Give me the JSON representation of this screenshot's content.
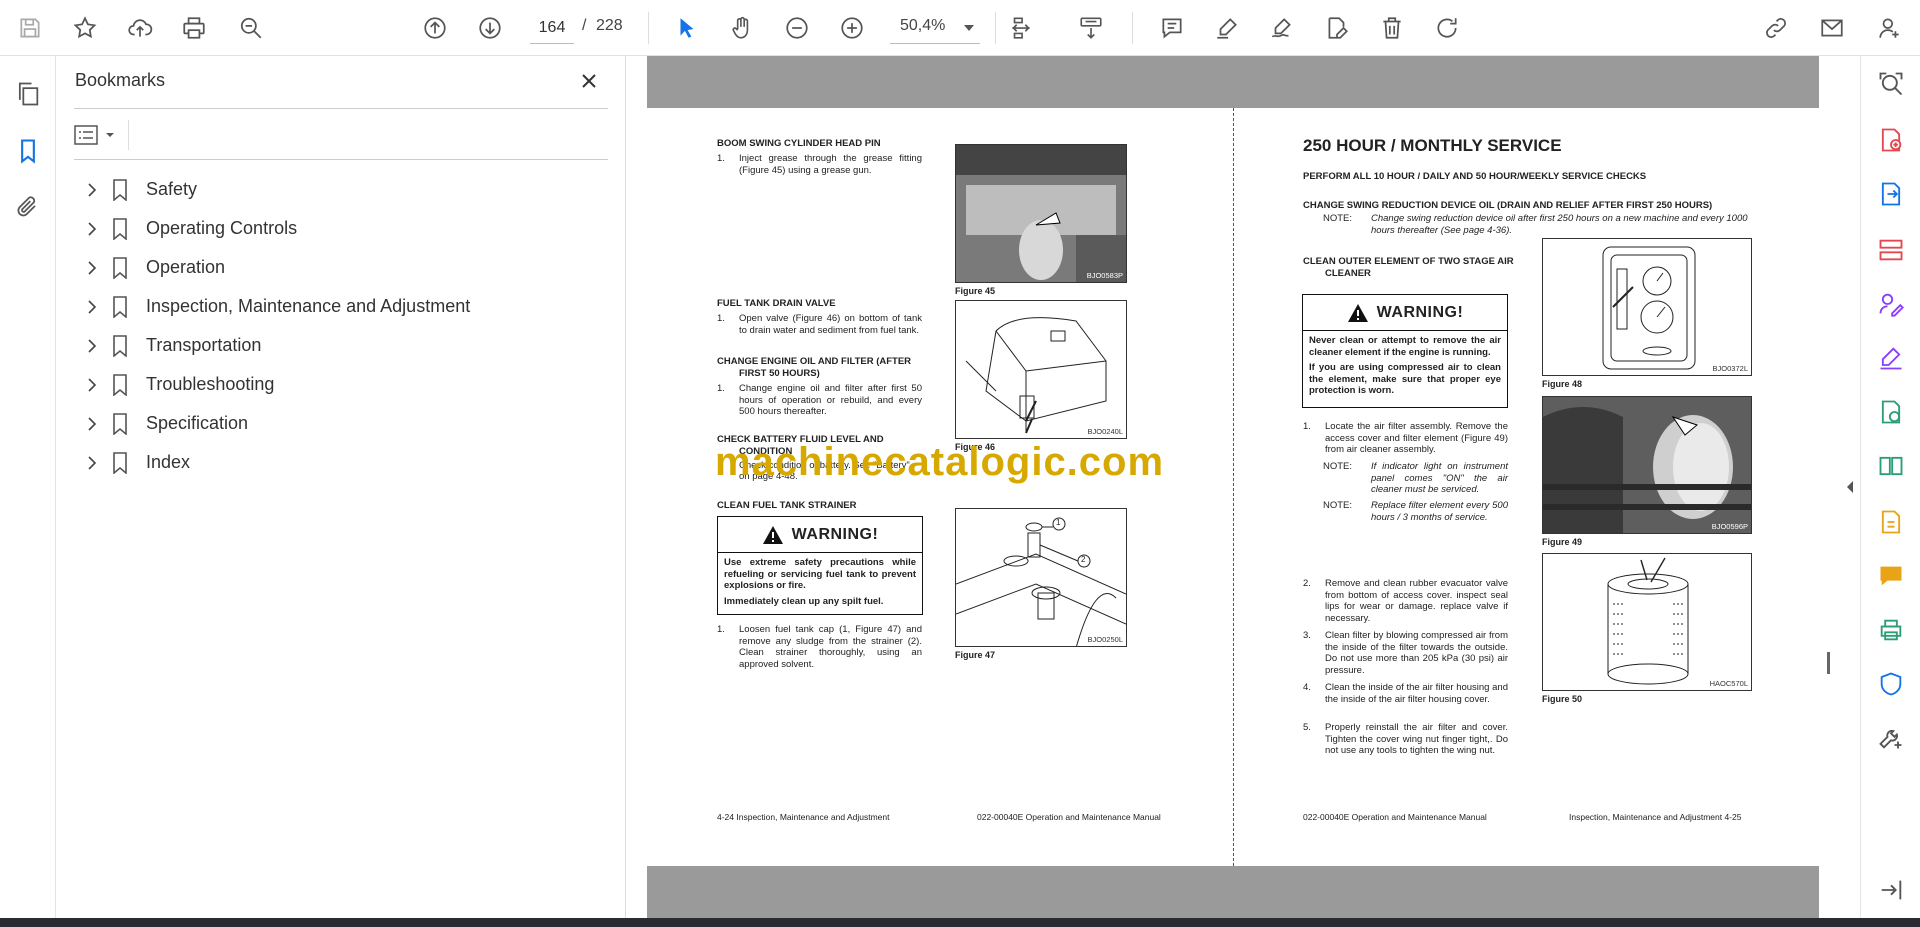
{
  "toolbar": {
    "page_current": "164",
    "page_separator": "/",
    "page_total": "228",
    "zoom": "50,4%",
    "icons": [
      "save-icon",
      "star-icon",
      "cloud-upload-icon",
      "print-icon",
      "search-zoom-icon",
      "arrow-up-icon",
      "arrow-down-icon",
      "cursor-icon",
      "hand-icon",
      "zoom-out-icon",
      "zoom-in-icon",
      "fit-page-icon",
      "scroll-mode-icon",
      "comment-icon",
      "highlight-icon",
      "sign-icon",
      "edit-icon",
      "trash-icon",
      "rotate-icon",
      "link-icon",
      "mail-icon",
      "account-icon"
    ]
  },
  "bookmarks": {
    "title": "Bookmarks",
    "items": [
      {
        "label": "Safety"
      },
      {
        "label": "Operating Controls"
      },
      {
        "label": "Operation"
      },
      {
        "label": "Inspection, Maintenance and Adjustment"
      },
      {
        "label": "Transportation"
      },
      {
        "label": "Troubleshooting"
      },
      {
        "label": "Specification"
      },
      {
        "label": "Index"
      }
    ]
  },
  "left_page": {
    "s1_title": "BOOM SWING CYLINDER HEAD PIN",
    "s1_num": "1.",
    "s1_text": "Inject grease through the grease fitting (Figure 45) using a grease gun.",
    "s2_title": "FUEL TANK DRAIN VALVE",
    "s2_num": "1.",
    "s2_text": "Open valve (Figure 46) on bottom of tank to drain water and sediment from fuel tank.",
    "s3_title_1": "CHANGE ENGINE OIL AND FILTER (AFTER",
    "s3_title_2": "FIRST 50 HOURS)",
    "s3_num": "1.",
    "s3_text": "Change engine oil and filter after first 50 hours of operation or rebuild, and every 500 hours thereafter.",
    "s4_title_1": "CHECK BATTERY FLUID LEVEL AND",
    "s4_title_2": "CONDITION",
    "s4_text_1": "Check condition of battery. See \"Battery\"",
    "s4_text_2": "on page 4-48.",
    "s5_title": "CLEAN FUEL TANK STRAINER",
    "warning_head": "WARNING!",
    "warning_p1": "Use extreme safety precautions while refueling or servicing fuel tank to prevent explosions or fire.",
    "warning_p2": "Immediately clean up any spilt fuel.",
    "s5_num": "1.",
    "s5_text": "Loosen fuel tank cap (1, Figure 47) and remove any sludge from the strainer (2). Clean strainer thoroughly, using an approved solvent.",
    "fig45_caption": "Figure 45",
    "fig45_code": "BJO0583P",
    "fig46_caption": "Figure 46",
    "fig46_code": "BJO0240L",
    "fig47_caption": "Figure 47",
    "fig47_code": "BJO0250L",
    "fig47_callout1": "1",
    "fig47_callout2": "2",
    "footer_left": "4-24  Inspection, Maintenance and Adjustment",
    "footer_right": "022-00040E Operation and Maintenance Manual"
  },
  "right_page": {
    "heading": "250 HOUR / MONTHLY SERVICE",
    "sub1": "PERFORM ALL 10 HOUR / DAILY AND 50 HOUR/WEEKLY SERVICE CHECKS",
    "sub2": "CHANGE SWING REDUCTION DEVICE OIL (DRAIN AND RELIEF AFTER FIRST 250 HOURS)",
    "note_label": "NOTE:",
    "note1": "Change swing reduction device oil after first 250 hours on a new machine and every 1000 hours thereafter (See page 4-36).",
    "sub3_1": "CLEAN OUTER ELEMENT OF TWO STAGE AIR",
    "sub3_2": "CLEANER",
    "warning_head": "WARNING!",
    "warning_p1": "Never clean or attempt to remove the air cleaner element if the engine is running.",
    "warning_p2": "If you are using compressed air to clean the element, make sure that proper eye protection is worn.",
    "i1_num": "1.",
    "i1_text": "Locate the air filter assembly. Remove the access cover and filter element (Figure 49) from air cleaner assembly.",
    "note2_label": "NOTE:",
    "note2": "If indicator light on instrument panel comes \"ON\" the air cleaner must be serviced.",
    "note3_label": "NOTE:",
    "note3": "Replace filter element every 500 hours / 3 months of service.",
    "i2_num": "2.",
    "i2_text": "Remove and clean rubber evacuator valve from bottom of access cover. inspect seal lips for wear or damage. replace valve if necessary.",
    "i3_num": "3.",
    "i3_text": "Clean filter by blowing compressed air from the inside of the filter towards the outside. Do not use more than 205 kPa (30 psi) air pressure.",
    "i4_num": "4.",
    "i4_text": "Clean the inside of the air filter housing and the inside of the air filter housing cover.",
    "i5_num": "5.",
    "i5_text": "Properly reinstall the air filter and cover. Tighten the cover wing nut finger tight,. Do not use any tools to tighten the wing nut.",
    "fig48_caption": "Figure 48",
    "fig48_code": "BJO0372L",
    "fig49_caption": "Figure 49",
    "fig49_code": "BJO0596P",
    "fig50_caption": "Figure 50",
    "fig50_code": "HAOC570L",
    "footer_left": "022-00040E Operation and Maintenance Manual",
    "footer_right": "Inspection, Maintenance and Adjustment 4-25"
  },
  "watermark": "machinecatalogic.com",
  "colors": {
    "accent_blue": "#1473e6",
    "rail_red": "#e34850",
    "rail_purple": "#8a3ffc",
    "rail_orange": "#e8a317",
    "rail_green": "#2d9d78",
    "watermark": "#d6a800"
  }
}
